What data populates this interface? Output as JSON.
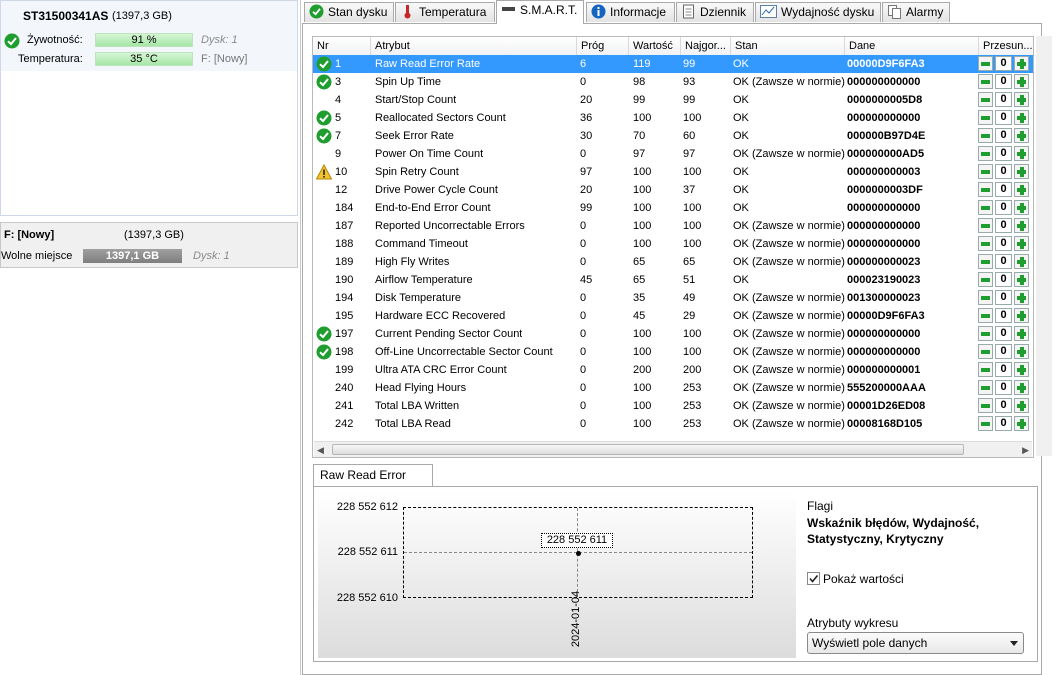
{
  "disk": {
    "name": "ST31500341AS",
    "size": "(1397,3 GB)",
    "health_label": "Żywotność:",
    "health_value": "91 %",
    "health_disk": "Dysk: 1",
    "temp_label": "Temperatura:",
    "temp_value": "35 °C",
    "temp_part_prefix": "F:",
    "temp_part": "[Nowy]"
  },
  "partition": {
    "name": "F: [Nowy]",
    "size": "(1397,3 GB)",
    "free_label": "Wolne miejsce",
    "free_value": "1397,1 GB",
    "disk": "Dysk: 1"
  },
  "tabs": [
    {
      "label": "Stan dysku"
    },
    {
      "label": "Temperatura"
    },
    {
      "label": "S.M.A.R.T."
    },
    {
      "label": "Informacje"
    },
    {
      "label": "Dziennik"
    },
    {
      "label": "Wydajność dysku"
    },
    {
      "label": "Alarmy"
    }
  ],
  "columns": [
    "Nr",
    "Atrybut",
    "Próg",
    "Wartość",
    "Najgor...",
    "Stan",
    "Dane",
    "Przesun..."
  ],
  "rows": [
    {
      "icon": "ok",
      "nr": "1",
      "attr": "Raw Read Error Rate",
      "thr": "6",
      "val": "119",
      "worst": "99",
      "state": "OK",
      "data": "00000D9F6FA3",
      "offset": "0",
      "selected": true
    },
    {
      "icon": "ok",
      "nr": "3",
      "attr": "Spin Up Time",
      "thr": "0",
      "val": "98",
      "worst": "93",
      "state": "OK (Zawsze w normie)",
      "data": "000000000000",
      "offset": "0"
    },
    {
      "icon": "",
      "nr": "4",
      "attr": "Start/Stop Count",
      "thr": "20",
      "val": "99",
      "worst": "99",
      "state": "OK",
      "data": "0000000005D8",
      "offset": "0"
    },
    {
      "icon": "ok",
      "nr": "5",
      "attr": "Reallocated Sectors Count",
      "thr": "36",
      "val": "100",
      "worst": "100",
      "state": "OK",
      "data": "000000000000",
      "offset": "0"
    },
    {
      "icon": "ok",
      "nr": "7",
      "attr": "Seek Error Rate",
      "thr": "30",
      "val": "70",
      "worst": "60",
      "state": "OK",
      "data": "000000B97D4E",
      "offset": "0"
    },
    {
      "icon": "",
      "nr": "9",
      "attr": "Power On Time Count",
      "thr": "0",
      "val": "97",
      "worst": "97",
      "state": "OK (Zawsze w normie)",
      "data": "000000000AD5",
      "offset": "0"
    },
    {
      "icon": "warn",
      "nr": "10",
      "attr": "Spin Retry Count",
      "thr": "97",
      "val": "100",
      "worst": "100",
      "state": "OK",
      "data": "000000000003",
      "offset": "0"
    },
    {
      "icon": "",
      "nr": "12",
      "attr": "Drive Power Cycle Count",
      "thr": "20",
      "val": "100",
      "worst": "37",
      "state": "OK",
      "data": "0000000003DF",
      "offset": "0"
    },
    {
      "icon": "",
      "nr": "184",
      "attr": "End-to-End Error Count",
      "thr": "99",
      "val": "100",
      "worst": "100",
      "state": "OK",
      "data": "000000000000",
      "offset": "0"
    },
    {
      "icon": "",
      "nr": "187",
      "attr": "Reported Uncorrectable Errors",
      "thr": "0",
      "val": "100",
      "worst": "100",
      "state": "OK (Zawsze w normie)",
      "data": "000000000000",
      "offset": "0"
    },
    {
      "icon": "",
      "nr": "188",
      "attr": "Command Timeout",
      "thr": "0",
      "val": "100",
      "worst": "100",
      "state": "OK (Zawsze w normie)",
      "data": "000000000000",
      "offset": "0"
    },
    {
      "icon": "",
      "nr": "189",
      "attr": "High Fly Writes",
      "thr": "0",
      "val": "65",
      "worst": "65",
      "state": "OK (Zawsze w normie)",
      "data": "000000000023",
      "offset": "0"
    },
    {
      "icon": "",
      "nr": "190",
      "attr": "Airflow Temperature",
      "thr": "45",
      "val": "65",
      "worst": "51",
      "state": "OK",
      "data": "000023190023",
      "offset": "0"
    },
    {
      "icon": "",
      "nr": "194",
      "attr": "Disk Temperature",
      "thr": "0",
      "val": "35",
      "worst": "49",
      "state": "OK (Zawsze w normie)",
      "data": "001300000023",
      "offset": "0"
    },
    {
      "icon": "",
      "nr": "195",
      "attr": "Hardware ECC Recovered",
      "thr": "0",
      "val": "45",
      "worst": "29",
      "state": "OK (Zawsze w normie)",
      "data": "00000D9F6FA3",
      "offset": "0"
    },
    {
      "icon": "ok",
      "nr": "197",
      "attr": "Current Pending Sector Count",
      "thr": "0",
      "val": "100",
      "worst": "100",
      "state": "OK (Zawsze w normie)",
      "data": "000000000000",
      "offset": "0"
    },
    {
      "icon": "ok",
      "nr": "198",
      "attr": "Off-Line Uncorrectable Sector Count",
      "thr": "0",
      "val": "100",
      "worst": "100",
      "state": "OK (Zawsze w normie)",
      "data": "000000000000",
      "offset": "0"
    },
    {
      "icon": "",
      "nr": "199",
      "attr": "Ultra ATA CRC Error Count",
      "thr": "0",
      "val": "200",
      "worst": "200",
      "state": "OK (Zawsze w normie)",
      "data": "000000000001",
      "offset": "0"
    },
    {
      "icon": "",
      "nr": "240",
      "attr": "Head Flying Hours",
      "thr": "0",
      "val": "100",
      "worst": "253",
      "state": "OK (Zawsze w normie)",
      "data": "555200000AAA",
      "offset": "0"
    },
    {
      "icon": "",
      "nr": "241",
      "attr": "Total LBA Written",
      "thr": "0",
      "val": "100",
      "worst": "253",
      "state": "OK (Zawsze w normie)",
      "data": "00001D26ED08",
      "offset": "0"
    },
    {
      "icon": "",
      "nr": "242",
      "attr": "Total LBA Read",
      "thr": "0",
      "val": "100",
      "worst": "253",
      "state": "OK (Zawsze w normie)",
      "data": "00008168D105",
      "offset": "0"
    }
  ],
  "chart": {
    "tab_label": "Raw Read Error Rate",
    "y_ticks": [
      "228 552 612",
      "228 552 611",
      "228 552 610"
    ],
    "point_label": "228 552 611",
    "x_label": "2024-01-04"
  },
  "chart_data": {
    "type": "scatter",
    "title": "Raw Read Error Rate",
    "x": [
      "2024-01-04"
    ],
    "y": [
      228552611
    ],
    "ylim": [
      228552610,
      228552612
    ],
    "grid": true
  },
  "side": {
    "flags_title": "Flagi",
    "flags_value": "Wskaźnik błędów, Wydajność, Statystyczny, Krytyczny",
    "show_values_label": "Pokaż wartości",
    "show_values_checked": true,
    "attr_title": "Atrybuty wykresu",
    "attr_select": "Wyświetl pole danych"
  },
  "colors": {
    "selection": "#3399ff",
    "ok_green": "#1f9e2f",
    "warn_yellow": "#f2c230"
  }
}
